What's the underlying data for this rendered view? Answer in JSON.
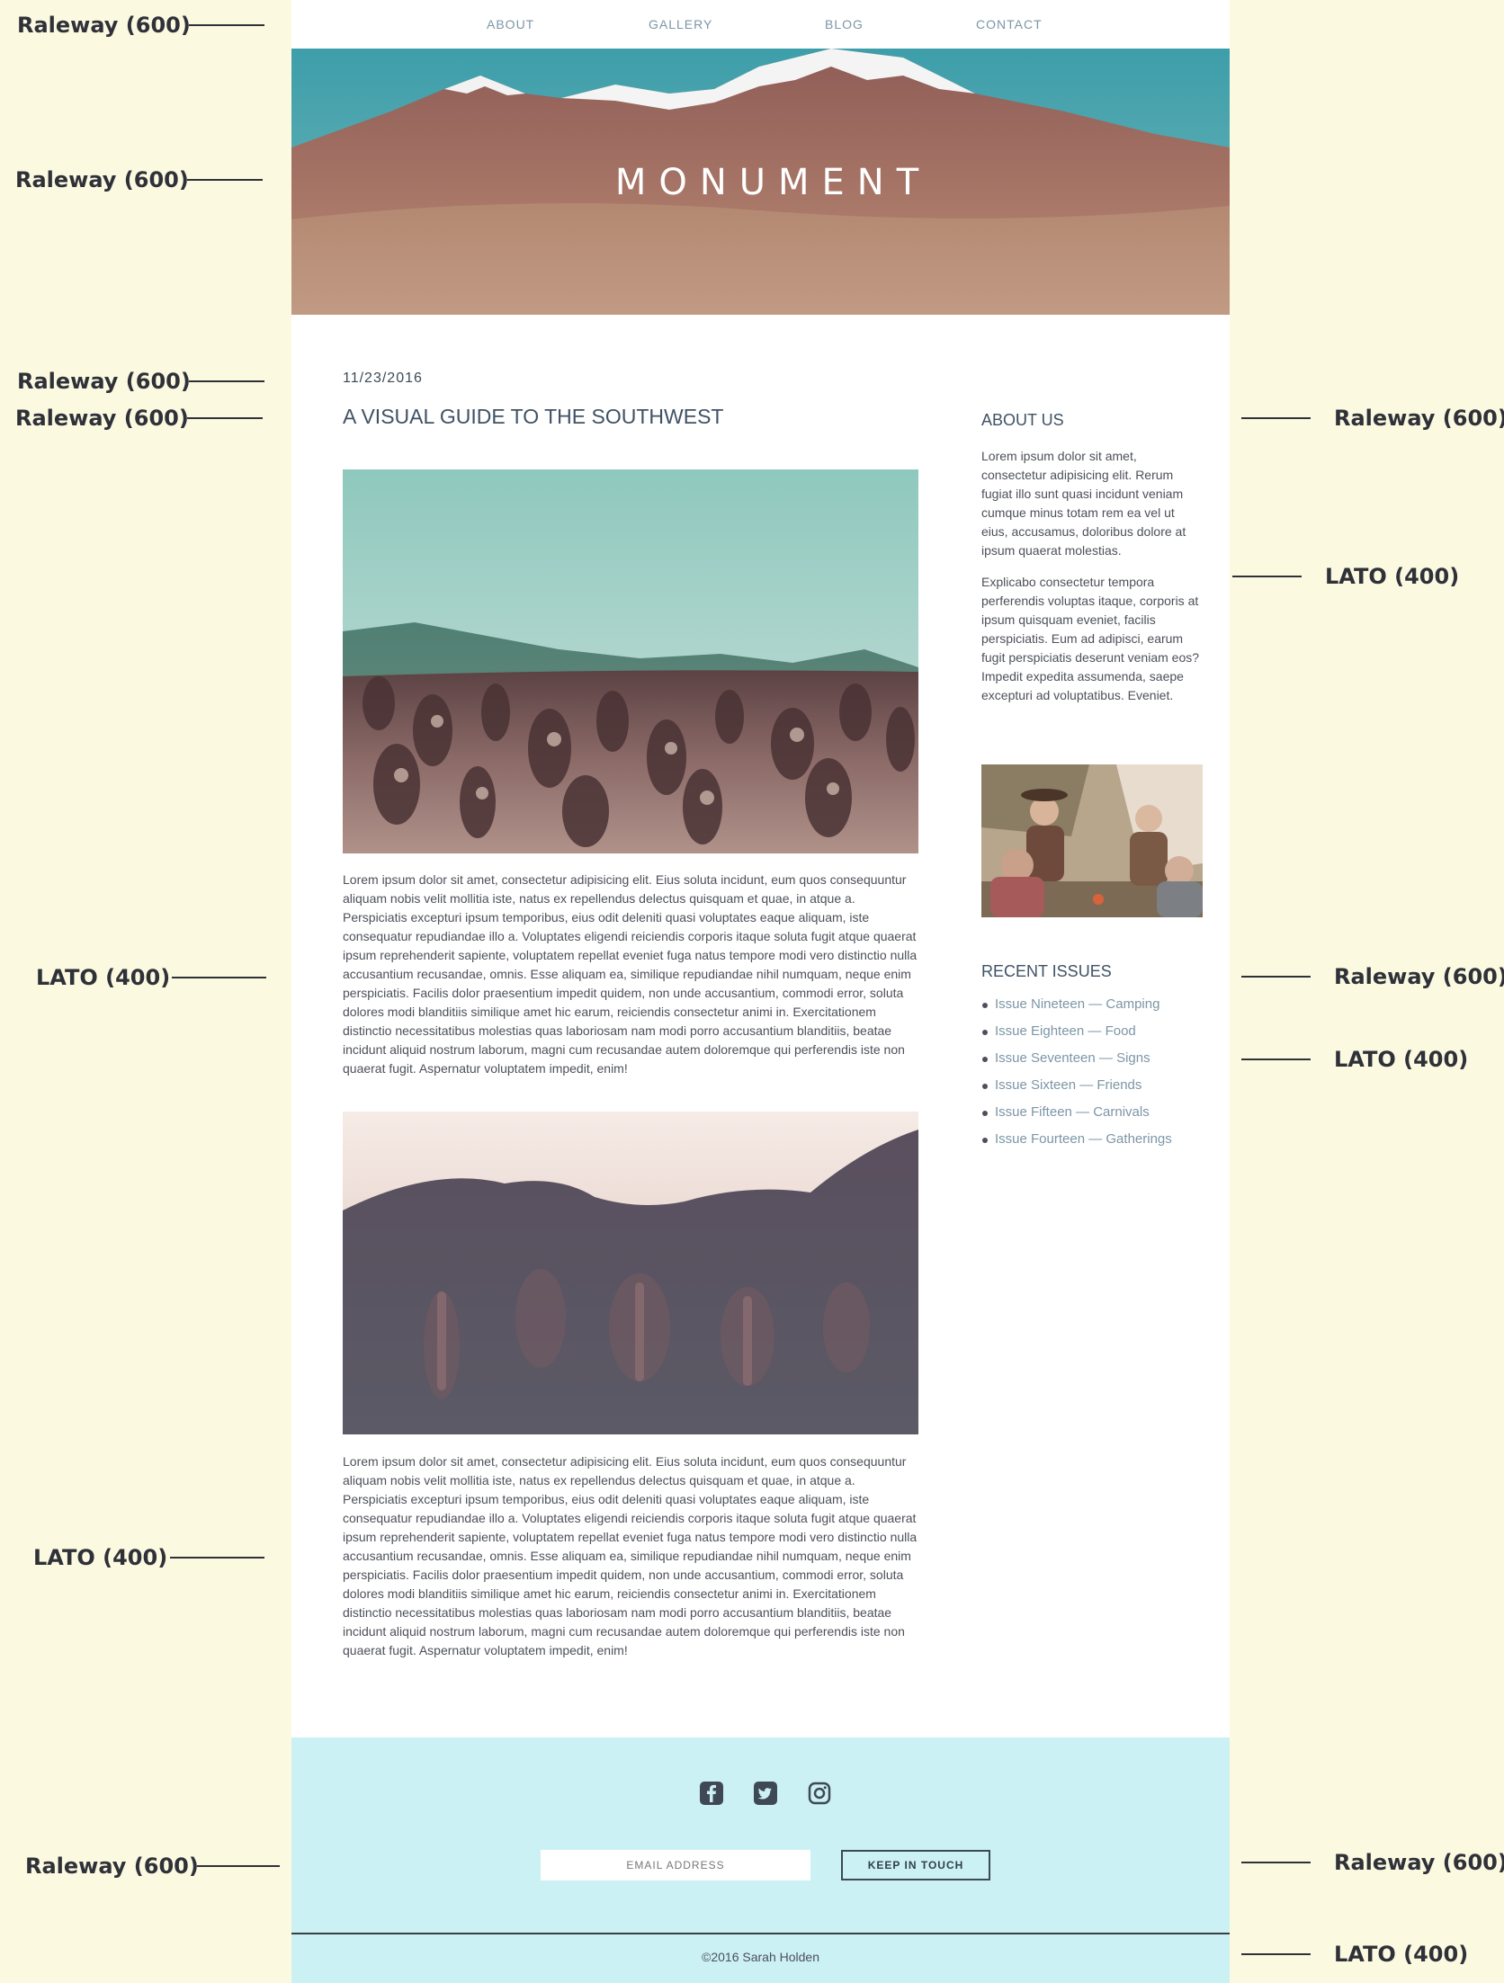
{
  "annotations": {
    "raleway_600": "Raleway (600)",
    "lato_400": "LATO (400)"
  },
  "nav": {
    "items": [
      "ABOUT",
      "GALLERY",
      "BLOG",
      "CONTACT"
    ]
  },
  "hero": {
    "title": "MONUMENT"
  },
  "post": {
    "date": "11/23/2016",
    "title": "A VISUAL GUIDE TO THE SOUTHWEST",
    "paragraphs": [
      "Lorem ipsum dolor sit amet, consectetur adipisicing elit. Eius soluta incidunt, eum quos consequuntur aliquam nobis velit mollitia iste, natus ex repellendus delectus quisquam et quae, in atque a. Perspiciatis excepturi ipsum temporibus, eius odit deleniti quasi voluptates eaque aliquam, iste consequatur repudiandae illo a. Voluptates eligendi reiciendis corporis itaque soluta fugit atque quaerat ipsum reprehenderit sapiente, voluptatem repellat eveniet fuga natus tempore modi vero distinctio nulla accusantium recusandae, omnis. Esse aliquam ea, similique repudiandae nihil numquam, neque enim perspiciatis. Facilis dolor praesentium impedit quidem, non unde accusantium, commodi error, soluta dolores modi blanditiis similique amet hic earum, reiciendis consectetur animi in. Exercitationem distinctio necessitatibus molestias quas laboriosam nam modi porro accusantium blanditiis, beatae incidunt aliquid nostrum laborum, magni cum recusandae autem doloremque qui perferendis iste non quaerat fugit. Aspernatur voluptatem impedit, enim!",
      "Lorem ipsum dolor sit amet, consectetur adipisicing elit. Eius soluta incidunt, eum quos consequuntur aliquam nobis velit mollitia iste, natus ex repellendus delectus quisquam et quae, in atque a. Perspiciatis excepturi ipsum temporibus, eius odit deleniti quasi voluptates eaque aliquam, iste consequatur repudiandae illo a. Voluptates eligendi reiciendis corporis itaque soluta fugit atque quaerat ipsum reprehenderit sapiente, voluptatem repellat eveniet fuga natus tempore modi vero distinctio nulla accusantium recusandae, omnis. Esse aliquam ea, similique repudiandae nihil numquam, neque enim perspiciatis. Facilis dolor praesentium impedit quidem, non unde accusantium, commodi error, soluta dolores modi blanditiis similique amet hic earum, reiciendis consectetur animi in. Exercitationem distinctio necessitatibus molestias quas laboriosam nam modi porro accusantium blanditiis, beatae incidunt aliquid nostrum laborum, magni cum recusandae autem doloremque qui perferendis iste non quaerat fugit. Aspernatur voluptatem impedit, enim!"
    ]
  },
  "sidebar": {
    "about_heading": "ABOUT US",
    "about_paragraphs": [
      "Lorem ipsum dolor sit amet, consectetur adipisicing elit. Rerum fugiat illo sunt quasi incidunt veniam cumque minus totam rem ea vel ut eius, accusamus, doloribus dolore at ipsum quaerat molestias.",
      "Explicabo consectetur tempora perferendis voluptas itaque, corporis at ipsum quisquam eveniet, facilis perspiciatis. Eum ad adipisci, earum fugit perspiciatis deserunt veniam eos? Impedit expedita assumenda, saepe excepturi ad voluptatibus. Eveniet."
    ],
    "issues_heading": "RECENT ISSUES",
    "issues": [
      "Issue Nineteen — Camping",
      "Issue Eighteen — Food",
      "Issue Seventeen — Signs",
      "Issue Sixteen — Friends",
      "Issue Fifteen — Carnivals",
      "Issue Fourteen — Gatherings"
    ]
  },
  "footer": {
    "social_icons": [
      "facebook-icon",
      "twitter-icon",
      "instagram-icon"
    ],
    "email_placeholder": "EMAIL ADDRESS",
    "button_label": "KEEP IN TOUCH",
    "copyright": "©2016 Sarah Holden"
  },
  "colors": {
    "background": "#fcf9e1",
    "page": "#ffffff",
    "footer": "#ccf1f4",
    "link": "#7c96a6",
    "heading": "#3f5264"
  }
}
